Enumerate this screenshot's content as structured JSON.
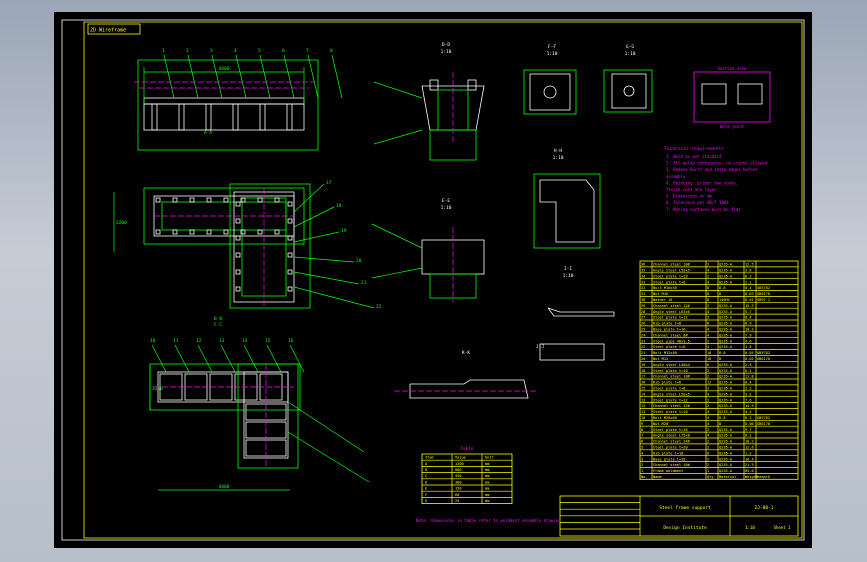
{
  "viewport": {
    "tab_label": "2D Wireframe",
    "background": "#000000",
    "colors": {
      "frame": "#ffff00",
      "geometry": "#ffffff",
      "dimension": "#00ff00",
      "note": "#ff00ff",
      "centerline": "#ff00ff",
      "table": "#ffff00"
    }
  },
  "views": {
    "front_view_label": "A-A",
    "plan_view_label": "B-B",
    "lower_view_label": "C-C",
    "detail_1": {
      "title": "D-D",
      "scale": "1:10"
    },
    "detail_2": {
      "title": "E-E",
      "scale": "1:10"
    },
    "detail_3": {
      "title": "F-F",
      "scale": "1:10"
    },
    "detail_4": {
      "title": "G-G",
      "scale": "1:10"
    },
    "detail_5": {
      "title": "H-H",
      "scale": "1:10"
    },
    "detail_6": {
      "title": "I-I",
      "scale": "1:10"
    },
    "detail_7": {
      "title": "J-J",
      "scale": ""
    },
    "detail_8": {
      "title": "K-K",
      "scale": ""
    },
    "dim_front_top": "4800",
    "dim_plan_width": "3200",
    "dim_lower_width": "3200",
    "dim_lower_bottom": "4800"
  },
  "balloons": {
    "front": [
      "1",
      "2",
      "3",
      "4",
      "5",
      "6",
      "7",
      "8"
    ],
    "lower": [
      "10",
      "11",
      "12",
      "13",
      "14",
      "15",
      "16"
    ],
    "side": [
      "17",
      "18",
      "19",
      "20",
      "21",
      "22"
    ]
  },
  "magenta_box": {
    "title": "Section view",
    "caption": "Weld joint"
  },
  "notes": {
    "title": "Technical requirements",
    "lines": [
      "1. Weld as per standard",
      "2. All welds continuous, no cracks allowed",
      "3. Remove burrs and sharp edges before",
      "   assembly",
      "4. Painting: primer two coats,",
      "   finish coat one layer",
      "5. Dimensions in mm",
      "6. Tolerance per GB/T 1804",
      "7. Mating surfaces must be flat"
    ]
  },
  "parts_list": {
    "rows": [
      [
        "36",
        "Channel steel 10#",
        "2",
        "Q235-A",
        "12.5",
        ""
      ],
      [
        "35",
        "Angle steel L50x5",
        "4",
        "Q235-A",
        "3.8",
        ""
      ],
      [
        "34",
        "Steel plate t=10",
        "2",
        "Q235-A",
        "6.2",
        ""
      ],
      [
        "33",
        "Steel plate t=8",
        "4",
        "Q235-A",
        "2.1",
        ""
      ],
      [
        "32",
        "Bolt M16x50",
        "8",
        "8.8",
        "0.1",
        "GB5782"
      ],
      [
        "31",
        "Nut M16",
        "8",
        "8",
        "0.03",
        "GB6170"
      ],
      [
        "30",
        "Washer 16",
        "8",
        "140HV",
        "0.01",
        "GB97.1"
      ],
      [
        "29",
        "Channel steel 12#",
        "2",
        "Q235-A",
        "15.3",
        ""
      ],
      [
        "28",
        "Angle steel L63x6",
        "4",
        "Q235-A",
        "5.7",
        ""
      ],
      [
        "27",
        "Steel plate t=12",
        "2",
        "Q235-A",
        "8.4",
        ""
      ],
      [
        "26",
        "Rib plate t=8",
        "8",
        "Q235-A",
        "0.9",
        ""
      ],
      [
        "25",
        "Base plate t=16",
        "4",
        "Q235-A",
        "10.2",
        ""
      ],
      [
        "24",
        "Channel steel 8#",
        "4",
        "Q235-A",
        "7.9",
        ""
      ],
      [
        "23",
        "Steel pipe 48x3.5",
        "2",
        "Q235-A",
        "4.6",
        ""
      ],
      [
        "22",
        "Steel plate t=6",
        "4",
        "Q235-A",
        "1.5",
        ""
      ],
      [
        "21",
        "Bolt M12x40",
        "16",
        "8.8",
        "0.05",
        "GB5782"
      ],
      [
        "20",
        "Nut M12",
        "16",
        "8",
        "0.02",
        "GB6170"
      ],
      [
        "19",
        "Angle steel L40x4",
        "6",
        "Q235-A",
        "2.4",
        ""
      ],
      [
        "18",
        "Steel plate t=10",
        "2",
        "Q235-A",
        "5.1",
        ""
      ],
      [
        "17",
        "Channel steel 10#",
        "2",
        "Q235-A",
        "11.8",
        ""
      ],
      [
        "16",
        "Rib plate t=6",
        "12",
        "Q235-A",
        "0.4",
        ""
      ],
      [
        "15",
        "Steel plate t=8",
        "2",
        "Q235-A",
        "3.3",
        ""
      ],
      [
        "14",
        "Angle steel L50x5",
        "4",
        "Q235-A",
        "3.2",
        ""
      ],
      [
        "13",
        "Steel plate t=12",
        "2",
        "Q235-A",
        "7.6",
        ""
      ],
      [
        "12",
        "Channel steel 12#",
        "2",
        "Q235-A",
        "14.9",
        ""
      ],
      [
        "11",
        "Steel plate t=10",
        "4",
        "Q235-A",
        "4.4",
        ""
      ],
      [
        "10",
        "Bolt M20x60",
        "4",
        "8.8",
        "0.2",
        "GB5782"
      ],
      [
        "9",
        "Nut M20",
        "4",
        "8",
        "0.06",
        "GB6170"
      ],
      [
        "8",
        "Steel plate t=16",
        "2",
        "Q235-A",
        "9.7",
        ""
      ],
      [
        "7",
        "Angle steel L75x8",
        "4",
        "Q235-A",
        "8.1",
        ""
      ],
      [
        "6",
        "Channel steel 14#",
        "2",
        "Q235-A",
        "18.2",
        ""
      ],
      [
        "5",
        "Steel plate t=20",
        "2",
        "Q235-A",
        "12.6",
        ""
      ],
      [
        "4",
        "Rib plate t=10",
        "8",
        "Q235-A",
        "1.2",
        ""
      ],
      [
        "3",
        "Base plate t=20",
        "2",
        "Q235-A",
        "16.4",
        ""
      ],
      [
        "2",
        "Channel steel 16#",
        "2",
        "Q235-A",
        "21.3",
        ""
      ],
      [
        "1",
        "Frame weldment",
        "1",
        "Q235-A",
        "85.0",
        ""
      ]
    ],
    "header": [
      "No.",
      "Name",
      "Qty",
      "Material",
      "Weight",
      "Remark"
    ]
  },
  "small_table": {
    "title": "Table",
    "rows": [
      [
        "Item",
        "Value",
        "Unit"
      ],
      [
        "A",
        "1200",
        "mm"
      ],
      [
        "B",
        "800",
        "mm"
      ],
      [
        "C",
        "450",
        "mm"
      ],
      [
        "D",
        "300",
        "mm"
      ],
      [
        "E",
        "150",
        "mm"
      ],
      [
        "F",
        "60",
        "mm"
      ],
      [
        "G",
        "25",
        "mm"
      ]
    ],
    "footnote": "Note: dimensions in table refer to weldment assembly drawing"
  },
  "title_block": {
    "drawing_name": "Steel frame support",
    "drawing_no": "ZJ-00-1",
    "scale": "1:10",
    "sheet": "Sheet 1",
    "company": "Design Institute"
  }
}
